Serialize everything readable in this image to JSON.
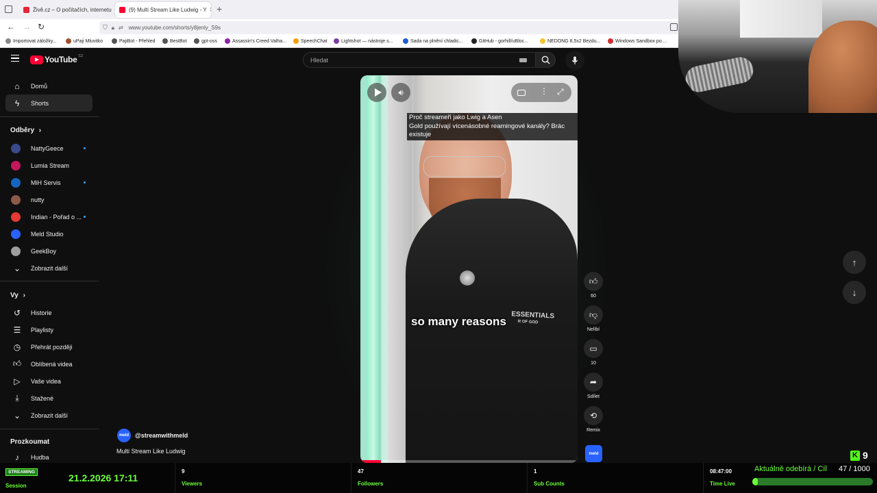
{
  "browser": {
    "tabs": [
      {
        "title": "Živě.cz – O počítačích, internetu",
        "color": "#e4263a"
      },
      {
        "title": "(9) Multi Stream Like Ludwig - Y",
        "color": "#ff0033"
      }
    ],
    "url": "www.youtube.com/shorts/y8jenly_S9s",
    "bookmarks": [
      "Importovat záložky...",
      "uPaji Mluvitko",
      "PajiBot - Přehled",
      "BestBot",
      "gpt-oss",
      "Assassin's Creed Valha...",
      "SpeechChat",
      "Lightshot — nástroje s...",
      "Sada na plnění chladic...",
      "GitHub - gorhill/uBloc...",
      "NEDONG 8,5x2 Bezdu...",
      "Windows Sandbox po ..."
    ]
  },
  "youtube": {
    "logo_text": "YouTube",
    "country": "CZ",
    "search_placeholder": "Hledat",
    "nav": [
      {
        "label": "Domů",
        "icon": "home-icon"
      },
      {
        "label": "Shorts",
        "icon": "shorts-icon",
        "active": true
      }
    ],
    "subs_title": "Odběry",
    "subscriptions": [
      {
        "name": "NattyGeece",
        "color": "#3b4a8c",
        "live": true
      },
      {
        "name": "Lumia Stream",
        "color": "#c2185b",
        "live": false
      },
      {
        "name": "MiH Servis",
        "color": "#1565c0",
        "live": true
      },
      {
        "name": "nutty",
        "color": "#8d5a4a",
        "live": false
      },
      {
        "name": "Indian - Pořad o ...",
        "color": "#e53935",
        "live": true
      },
      {
        "name": "Meld Studio",
        "color": "#2962ff",
        "live": false
      },
      {
        "name": "GeekBoy",
        "color": "#9e9e9e",
        "live": false
      }
    ],
    "show_more": "Zobrazit další",
    "you_title": "Vy",
    "you_items": [
      {
        "label": "Historie",
        "icon": "history-icon"
      },
      {
        "label": "Playlisty",
        "icon": "playlists-icon"
      },
      {
        "label": "Přehrát později",
        "icon": "watch-later-icon"
      },
      {
        "label": "Oblíbená videa",
        "icon": "liked-icon"
      },
      {
        "label": "Vaše videa",
        "icon": "your-videos-icon"
      },
      {
        "label": "Stažené",
        "icon": "downloads-icon"
      }
    ],
    "show_more_2": "Zobrazit další",
    "explore_title": "Prozkoumat",
    "explore_items": [
      {
        "label": "Hudba",
        "icon": "music-icon"
      }
    ],
    "short": {
      "channel": "@streamwithmeld",
      "channel_logo": "meld",
      "title": "Multi Stream Like Ludwig",
      "caption_lines": [
        "Proč streameři jako Lwig a Asen",
        "Gold používají vícenásobné reamingové kanály?  Brác",
        "existuje"
      ],
      "subtitle": "so many reasons",
      "hoodie_text": "ESSENTIALS",
      "hoodie_sub": "R OF GOD"
    },
    "actions": [
      {
        "label": "60",
        "icon": "like-icon"
      },
      {
        "label": "Nelíbí",
        "icon": "dislike-icon"
      },
      {
        "label": "10",
        "icon": "comment-icon"
      },
      {
        "label": "Sdílet",
        "icon": "share-icon"
      },
      {
        "label": "Remix",
        "icon": "remix-icon"
      }
    ]
  },
  "overlay": {
    "badge": "STREAMING",
    "session_label": "Session",
    "datetime": "21.2.2026 17:11",
    "viewers_value": "9",
    "viewers_label": "Viewers",
    "followers_value": "47",
    "followers_label": "Followers",
    "subs_value": "1",
    "subs_label": "Sub Counts",
    "time_value": "08:47:00",
    "time_label": "Time Live",
    "goal_text": "Aktuálně odebírá / Cíl",
    "goal_count": "47 / 1000",
    "goal_progress": 0.047,
    "kick_count": "9"
  }
}
